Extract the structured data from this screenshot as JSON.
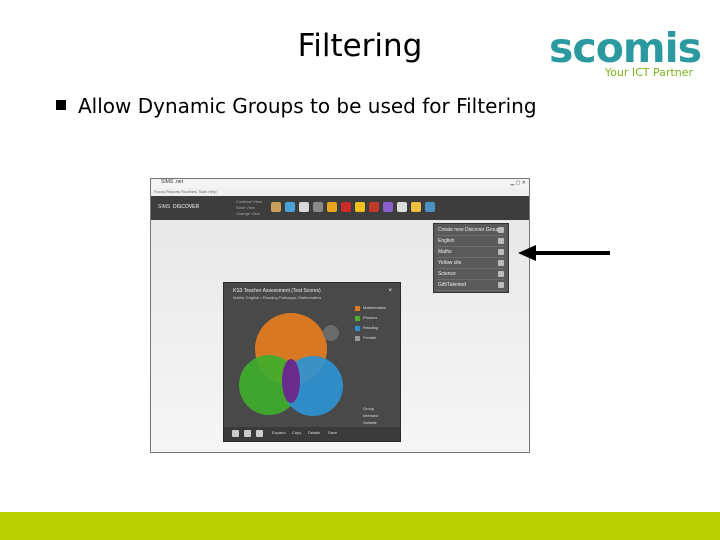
{
  "slide": {
    "title": "Filtering",
    "bullet": "Allow Dynamic Groups to be used for Filtering"
  },
  "logo": {
    "word": "scomis",
    "tagline": "Your ICT Partner",
    "colors": {
      "word": "#2b9aa0",
      "tagline": "#7bb41c",
      "dot": "#9ccf14"
    }
  },
  "footer_color": "#b8d000",
  "app": {
    "window_title": "SIMS .net",
    "menu_text": "Focus  Reports  Routines  Tools  Help",
    "toolbar": {
      "home": "SIMS",
      "discover": "DISCOVER",
      "sub_items": [
        "Continue View",
        "Save View",
        "Change View"
      ],
      "icons": [
        "tool-icon-1",
        "tool-icon-2",
        "tool-icon-3",
        "tool-icon-4",
        "tool-icon-5",
        "tool-icon-6",
        "tool-icon-7",
        "tool-icon-8",
        "tool-icon-9",
        "tool-icon-10",
        "tool-icon-11",
        "tool-icon-12"
      ]
    },
    "dropdown": {
      "items": [
        "Create new Discover Group",
        "English",
        "Maths",
        "Yellow site",
        "Science",
        "Gift/Talented"
      ]
    },
    "panel": {
      "title": "KS3 Teacher Assessment (Test Scores)",
      "subtitle": "Maths, English  •  Reading Pathways, Mathematics",
      "close": "×",
      "legend": [
        {
          "label": "Mathematics",
          "color": "#e07a20"
        },
        {
          "label": "Phonics",
          "color": "#4caf2a"
        },
        {
          "label": "Reading",
          "color": "#2e8fd0"
        },
        {
          "label": "Female",
          "color": "#999999"
        }
      ],
      "venn_values": [
        "",
        "",
        "",
        "",
        "",
        "",
        "",
        ""
      ],
      "key": [
        "Group",
        "Intersect",
        "Outside"
      ],
      "bottom_buttons": [
        "Expand",
        "Copy",
        "Details",
        "Save"
      ]
    }
  }
}
